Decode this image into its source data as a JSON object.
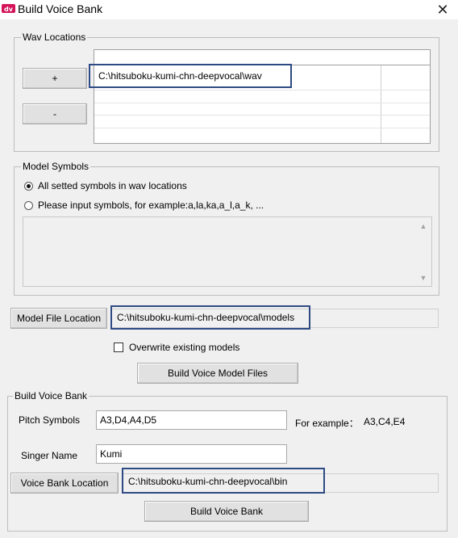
{
  "window": {
    "title": "Build Voice Bank",
    "close_icon": "close-icon",
    "app_icon": "dv-logo-icon"
  },
  "wav_locations": {
    "group_label": "Wav Locations",
    "add_label": "+",
    "remove_label": "-",
    "paths": [
      "C:\\hitsuboku-kumi-chn-deepvocal\\wav"
    ]
  },
  "model_symbols": {
    "group_label": "Model Symbols",
    "option_all": "All setted symbols in wav locations",
    "option_input": "Please input symbols, for example:a,la,ka,a_l,a_k, ...",
    "selected": "all",
    "symbols_text": ""
  },
  "model_file": {
    "button_label": "Model File Location",
    "path": "C:\\hitsuboku-kumi-chn-deepvocal\\models",
    "overwrite_label": "Overwrite existing models",
    "overwrite_checked": false,
    "build_models_label": "Build Voice Model Files"
  },
  "build_voice_bank": {
    "group_label": "Build Voice Bank",
    "pitch_label": "Pitch Symbols",
    "pitch_value": "A3,D4,A4,D5",
    "example_label": "For example：",
    "example_value": "A3,C4,E4",
    "singer_label": "Singer Name",
    "singer_value": "Kumi",
    "location_button_label": "Voice Bank Location",
    "location_path": "C:\\hitsuboku-kumi-chn-deepvocal\\bin",
    "build_label": "Build Voice Bank"
  },
  "colors": {
    "highlight": "#2e4a83",
    "background": "#f0f0f0"
  }
}
